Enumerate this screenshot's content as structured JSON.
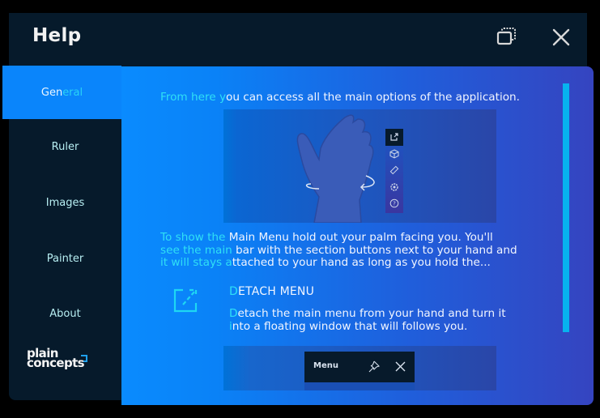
{
  "window": {
    "title": "Help",
    "restore_icon": "restore-window-icon",
    "close_icon": "close-icon"
  },
  "sidebar": {
    "items": [
      {
        "label_a": "Gen",
        "label_b": "eral",
        "active": true
      },
      {
        "label": "Ruler",
        "active": false
      },
      {
        "label": "Images",
        "active": false
      },
      {
        "label": "Painter",
        "active": false
      },
      {
        "label": "About",
        "active": false
      }
    ],
    "logo": {
      "line1": "plain",
      "line2": "concepts"
    }
  },
  "content": {
    "intro": {
      "fade": "From here y",
      "rest": "ou can access all the main options of the application."
    },
    "illustration1": {
      "description": "hand palm facing user with rotation arrows and main bar",
      "bar_icons": [
        "detach-icon",
        "cube-icon",
        "ruler-icon",
        "gear-icon",
        "help-icon"
      ]
    },
    "main_menu_para": {
      "line1_fade": "To show the ",
      "line1_rest": "Main Menu hold out your  palm facing you. You'll",
      "line2_fade": "see the main ",
      "line2_rest": "bar with the section buttons next to your hand and",
      "line3_fade": "it will stays a",
      "line3_rest": "ttached to your hand as long as you hold the..."
    },
    "detach": {
      "icon": "detach-icon",
      "title_fade": "D",
      "title_rest": "ETACH MENU",
      "line1_fade": "D",
      "line1_rest": "etach the main menu from your hand and turn it",
      "line2_fade": "i",
      "line2_rest": "nto a floating window that will follows you."
    },
    "illustration2": {
      "menu_label": "Menu",
      "pin_icon": "pin-icon",
      "close_icon": "close-icon"
    }
  },
  "colors": {
    "window_bg": "#061a2b",
    "accent_blue": "#0a85fb",
    "cyan_highlight": "#2fe0f5",
    "scrollbar": "#07b3ef",
    "content_gradient_end": "#3544c0"
  }
}
